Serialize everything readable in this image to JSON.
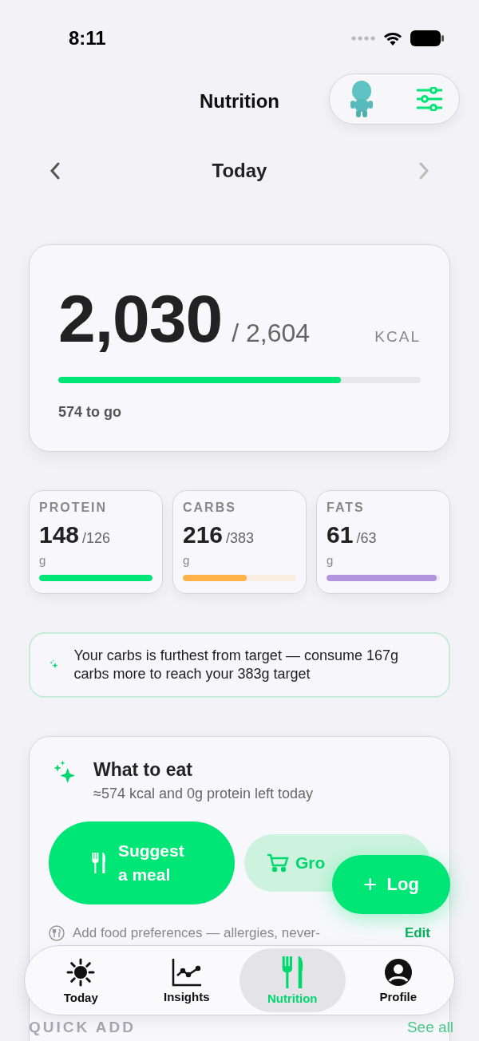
{
  "status_bar": {
    "time": "8:11"
  },
  "header": {
    "title": "Nutrition"
  },
  "date_nav": {
    "label": "Today",
    "next_disabled": true
  },
  "calories": {
    "eaten": "2,030",
    "target": "/ 2,604",
    "unit": "KCAL",
    "level": 0.78,
    "remaining": "574 to go"
  },
  "macros": [
    {
      "name": "PROTEIN",
      "value": "148",
      "target": "/126",
      "unit": "g",
      "level": 1.0,
      "color": "#00e676"
    },
    {
      "name": "CARBS",
      "value": "216",
      "target": "/383",
      "unit": "g",
      "level": 0.56,
      "color": "#ffb347"
    },
    {
      "name": "FATS",
      "value": "61",
      "target": "/63",
      "unit": "g",
      "level": 0.97,
      "color": "#b295de"
    }
  ],
  "insight": {
    "text": "Your carbs is furthest from target — consume 167g carbs more to reach your 383g target"
  },
  "what_to_eat": {
    "title": "What to eat",
    "subtitle": "≈574 kcal and 0g protein left today",
    "primary_button": "Suggest a meal",
    "secondary_button": "Gro",
    "preferences": "Add food preferences — allergies, never-",
    "edit": "Edit"
  },
  "quick_add": {
    "title": "QUICK ADD",
    "link": "See all"
  },
  "fab": {
    "label": "Log",
    "icon": "+"
  },
  "tabs": [
    {
      "label": "Today",
      "kind": "sun",
      "selected": false
    },
    {
      "label": "Insights",
      "kind": "chart",
      "selected": false
    },
    {
      "label": "Nutrition",
      "kind": "fork",
      "selected": true
    },
    {
      "label": "Profile",
      "kind": "person",
      "selected": false
    }
  ]
}
